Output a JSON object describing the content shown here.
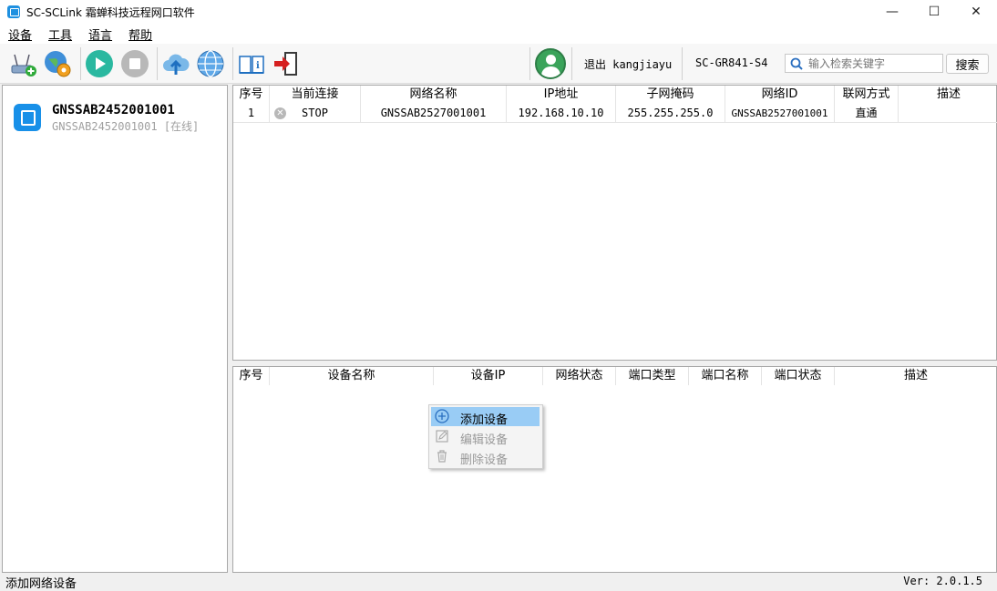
{
  "window": {
    "title": "SC-SCLink 霜蝉科技远程网口软件",
    "minimize": "—",
    "maximize": "☐",
    "close": "✕"
  },
  "menu": [
    {
      "label": "设备",
      "accel": "设"
    },
    {
      "label": "工具",
      "accel": "工"
    },
    {
      "label": "语言",
      "accel": "语"
    },
    {
      "label": "帮助",
      "accel": "帮"
    }
  ],
  "toolbar": {
    "logout": "退出 kangjiayu",
    "device_model": "SC-GR841-S4",
    "search_placeholder": "输入检索关键字",
    "search_button": "搜索"
  },
  "devices": [
    {
      "name": "GNSSAB2452001001",
      "subtitle": "GNSSAB2452001001 [在线]"
    }
  ],
  "network_table": {
    "headers": [
      "序号",
      "当前连接",
      "网络名称",
      "IP地址",
      "子网掩码",
      "网络ID",
      "联网方式",
      "描述"
    ],
    "rows": [
      {
        "index": "1",
        "connection": "STOP",
        "name": "GNSSAB2527001001",
        "ip": "192.168.10.10",
        "mask": "255.255.255.0",
        "net_id": "GNSSAB2527001001",
        "mode": "直通",
        "desc": ""
      }
    ]
  },
  "device_table": {
    "headers": [
      "序号",
      "设备名称",
      "设备IP",
      "网络状态",
      "端口类型",
      "端口名称",
      "端口状态",
      "描述"
    ]
  },
  "context_menu": [
    {
      "label": "添加设备",
      "icon": "plus-circle-icon",
      "enabled": true,
      "highlighted": true
    },
    {
      "label": "编辑设备",
      "icon": "edit-icon",
      "enabled": false,
      "highlighted": false
    },
    {
      "label": "删除设备",
      "icon": "trash-icon",
      "enabled": false,
      "highlighted": false
    }
  ],
  "status": {
    "message": "添加网络设备",
    "version": "Ver: 2.0.1.5"
  },
  "colors": {
    "accent": "#1890e8",
    "highlight": "#99ccf5",
    "user_green": "#3aa35a",
    "stop_red": "#d62020"
  }
}
